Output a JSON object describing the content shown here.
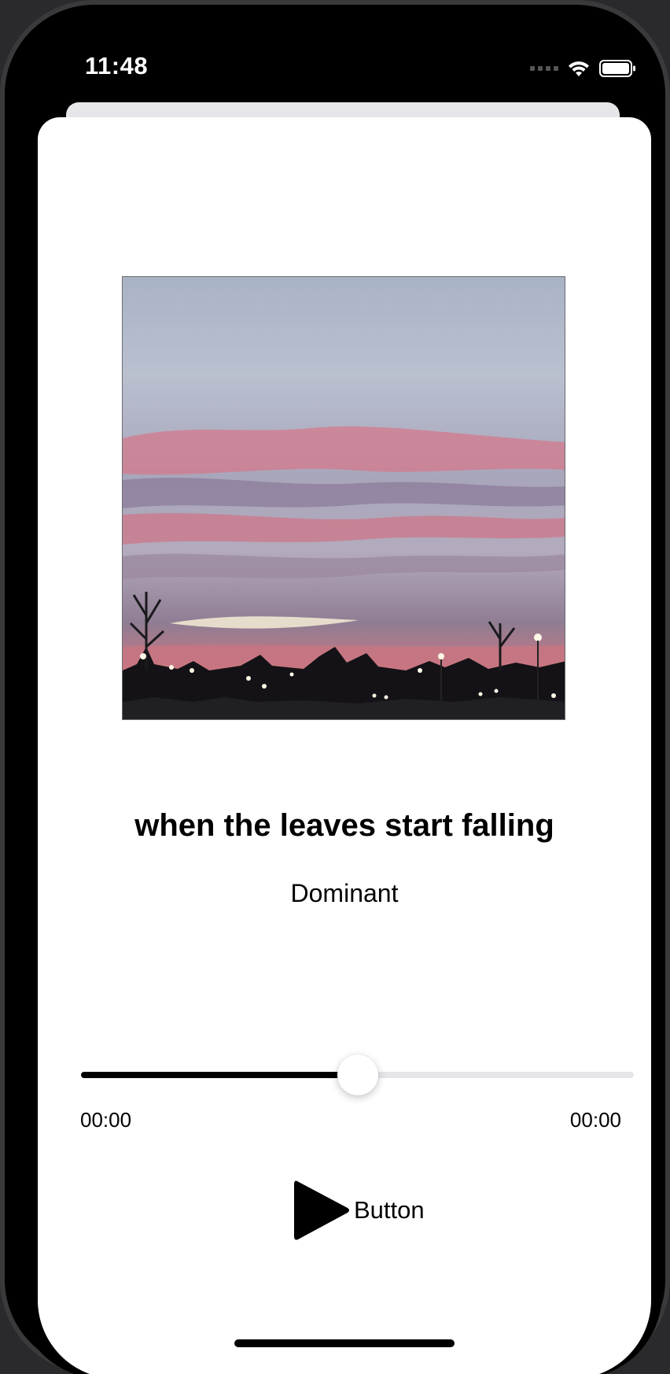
{
  "status_bar": {
    "time": "11:48",
    "icons": [
      "cellular-signal-icon",
      "wifi-icon",
      "battery-icon"
    ]
  },
  "now_playing": {
    "artwork_description_icon": "album-artwork-sunset",
    "title": "when the leaves start falling",
    "artist": "Dominant"
  },
  "player": {
    "progress": 0.5,
    "elapsed_time": "00:00",
    "total_time": "00:00",
    "play_button_label": "Button",
    "play_icon": "play-icon"
  },
  "colors": {
    "accent": "#000000",
    "track": "#e5e5ea",
    "card_background": "#ffffff",
    "frame": "#000000"
  }
}
